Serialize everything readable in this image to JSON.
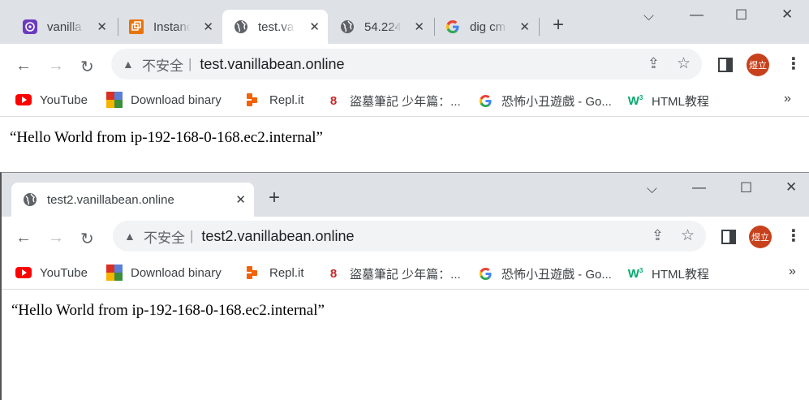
{
  "window1": {
    "tabs": [
      {
        "title": "vanilla",
        "favicon": "vanilla-icon",
        "active": false
      },
      {
        "title": "Instanc",
        "favicon": "aws-icon",
        "active": false
      },
      {
        "title": "test.va",
        "favicon": "globe-icon",
        "active": true
      },
      {
        "title": "54.224",
        "favicon": "globe-icon",
        "active": false
      },
      {
        "title": "dig cm",
        "favicon": "google-icon",
        "active": false
      }
    ],
    "omnibox": {
      "security": "不安全",
      "separator": "|",
      "url": "test.vanillabean.online"
    },
    "avatar_text": "煜立",
    "content_text": "“Hello World from ip-192-168-0-168.ec2.internal”"
  },
  "window2": {
    "tabs": [
      {
        "title": "test2.vanillabean.online",
        "favicon": "globe-icon",
        "active": true
      }
    ],
    "omnibox": {
      "security": "不安全",
      "separator": "|",
      "url": "test2.vanillabean.online"
    },
    "avatar_text": "煜立",
    "content_text": "“Hello World from ip-192-168-0-168.ec2.internal”"
  },
  "bookmarks": [
    {
      "label": "YouTube",
      "icon": "youtube-icon"
    },
    {
      "label": "Download binary",
      "icon": "download-binary-icon"
    },
    {
      "label": "Repl.it",
      "icon": "replit-icon"
    },
    {
      "label": "盜墓筆記 少年篇：...",
      "icon": "number-8-icon"
    },
    {
      "label": "恐怖小丑遊戲 - Go...",
      "icon": "google-icon"
    },
    {
      "label": "HTML教程",
      "icon": "w3schools-icon"
    }
  ],
  "bookmarks_more": "»",
  "colors": {
    "tabstrip": "#dee1e6",
    "omnibox": "#f1f3f4",
    "avatar": "#c7421c",
    "youtube": "#ff0000",
    "replit": "#f26207",
    "w3": "#04aa6d"
  }
}
